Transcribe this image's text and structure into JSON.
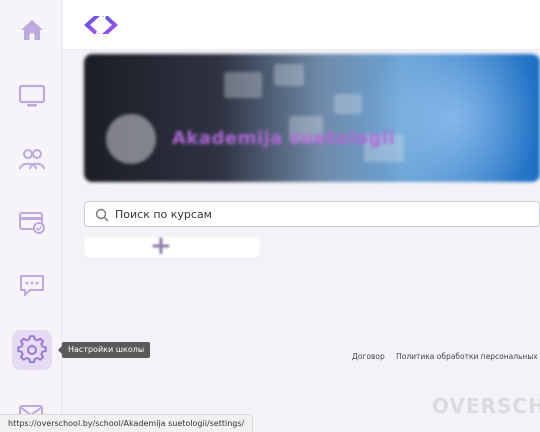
{
  "sidebar": {
    "items": [
      {
        "name": "home",
        "icon": "home-icon"
      },
      {
        "name": "courses",
        "icon": "monitor-icon"
      },
      {
        "name": "students",
        "icon": "users-icon"
      },
      {
        "name": "payments",
        "icon": "card-icon"
      },
      {
        "name": "messages",
        "icon": "chat-icon"
      },
      {
        "name": "settings",
        "icon": "gear-icon",
        "active": true
      },
      {
        "name": "mail",
        "icon": "mail-icon"
      }
    ],
    "accent_color": "#9d79d8",
    "icon_color": "#bba9e0"
  },
  "header": {
    "logo_icon": "overschool-logo-icon"
  },
  "banner": {
    "school_title": "Akademija suetologii"
  },
  "search": {
    "placeholder": "Поиск по курсам"
  },
  "add_course": {
    "symbol": "+"
  },
  "tooltip": {
    "text": "Настройки школы"
  },
  "footer": {
    "contract": "Договор",
    "privacy": "Политика обработки персональных данн"
  },
  "watermark": {
    "brand": "OVERSCH"
  },
  "status_bar": {
    "url": "https://overschool.by/school/Akademija suetologii/settings/"
  }
}
